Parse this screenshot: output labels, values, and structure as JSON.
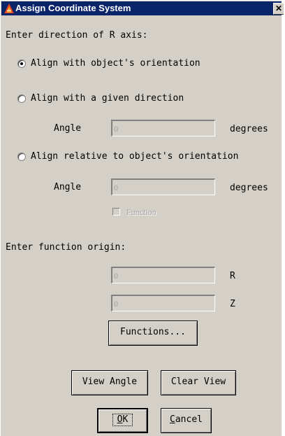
{
  "window": {
    "title": "Assign Coordinate System",
    "close_glyph": "✕",
    "logo_icon": "app-logo-icon"
  },
  "r_axis": {
    "heading": "Enter direction of R axis:",
    "options": [
      {
        "label": "Align with object's orientation",
        "checked": true
      },
      {
        "label": "Align with a given direction",
        "checked": false
      },
      {
        "label": "Align relative to object's orientation",
        "checked": false
      }
    ],
    "given_direction": {
      "label": "Angle",
      "value": "0",
      "unit": "degrees"
    },
    "relative": {
      "label": "Angle",
      "value": "0",
      "unit": "degrees"
    },
    "function_checkbox": {
      "label": "Function",
      "checked": false,
      "enabled": false
    }
  },
  "origin": {
    "heading": "Enter function origin:",
    "r": {
      "value": "0",
      "unit": "R"
    },
    "z": {
      "value": "0",
      "unit": "Z"
    },
    "functions_button": "Functions..."
  },
  "buttons": {
    "view_angle": "View Angle",
    "clear_view": "Clear View",
    "ok": "OK",
    "cancel": "Cancel"
  }
}
